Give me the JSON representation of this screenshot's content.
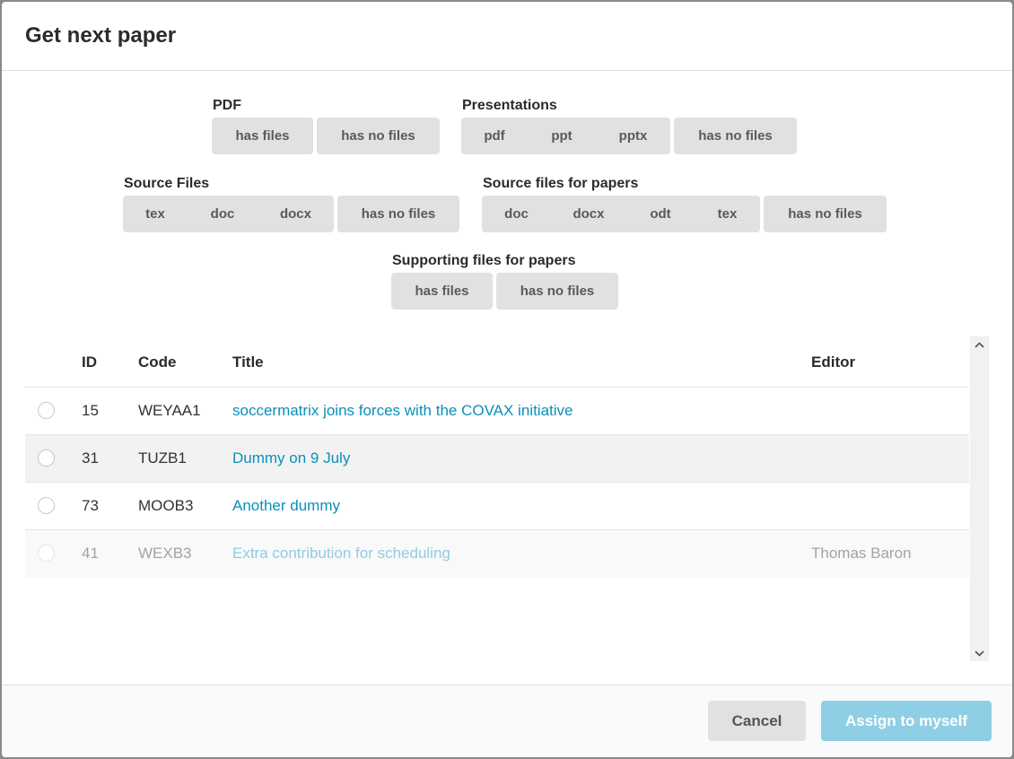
{
  "dialog": {
    "title": "Get next paper"
  },
  "filters": {
    "pdf": {
      "label": "PDF",
      "groups": [
        [
          "has files"
        ],
        [
          "has no files"
        ]
      ]
    },
    "presentations": {
      "label": "Presentations",
      "groups": [
        [
          "pdf",
          "ppt",
          "pptx"
        ],
        [
          "has no files"
        ]
      ]
    },
    "source_files": {
      "label": "Source Files",
      "groups": [
        [
          "tex",
          "doc",
          "docx"
        ],
        [
          "has no files"
        ]
      ]
    },
    "source_files_papers": {
      "label": "Source files for papers",
      "groups": [
        [
          "doc",
          "docx",
          "odt",
          "tex"
        ],
        [
          "has no files"
        ]
      ]
    },
    "supporting_files": {
      "label": "Supporting files for papers",
      "groups": [
        [
          "has files"
        ],
        [
          "has no files"
        ]
      ]
    }
  },
  "table": {
    "headers": {
      "id": "ID",
      "code": "Code",
      "title": "Title",
      "editor": "Editor"
    },
    "rows": [
      {
        "id": "15",
        "code": "WEYAA1",
        "title": "soccermatrix joins forces with the COVAX initiative",
        "editor": ""
      },
      {
        "id": "31",
        "code": "TUZB1",
        "title": "Dummy on 9 July",
        "editor": ""
      },
      {
        "id": "73",
        "code": "MOOB3",
        "title": "Another dummy",
        "editor": ""
      },
      {
        "id": "41",
        "code": "WEXB3",
        "title": "Extra contribution for scheduling",
        "editor": "Thomas Baron"
      }
    ]
  },
  "footer": {
    "cancel_label": "Cancel",
    "assign_label": "Assign to myself"
  },
  "colors": {
    "link": "#0b8fba",
    "primary_disabled": "#8fcfe6",
    "button_grey": "#e0e1e2"
  }
}
